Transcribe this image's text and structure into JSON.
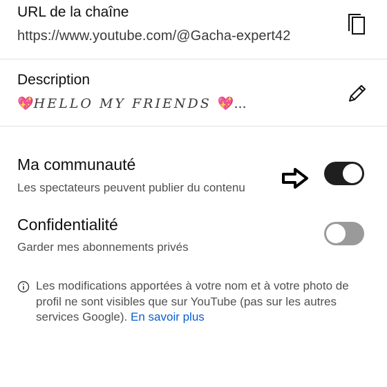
{
  "channel_url": {
    "label": "URL de la chaîne",
    "value": "https://www.youtube.com/@Gacha-expert42",
    "copy_icon": "copy-icon"
  },
  "description": {
    "label": "Description",
    "heart_left": "💖",
    "value": "HELLO MY FRIENDS",
    "heart_right": "💖",
    "ellipsis": "...",
    "edit_icon": "pencil-icon"
  },
  "community": {
    "title": "Ma communauté",
    "subtitle": "Les spectateurs peuvent publier du contenu",
    "enabled": true,
    "annotation_icon": "arrow-right-icon"
  },
  "privacy": {
    "title": "Confidentialité",
    "subtitle": "Garder mes abonnements privés",
    "enabled": false
  },
  "notice": {
    "icon": "info-icon",
    "text": "Les modifications apportées à votre nom et à votre photo de profil ne sont visibles que sur YouTube (pas sur les autres services Google).",
    "link": "En savoir plus"
  },
  "colors": {
    "toggle_on": "#1f1f1f",
    "toggle_off": "#9a9a9a",
    "link": "#065fd4",
    "divider": "#e2e2e2"
  }
}
